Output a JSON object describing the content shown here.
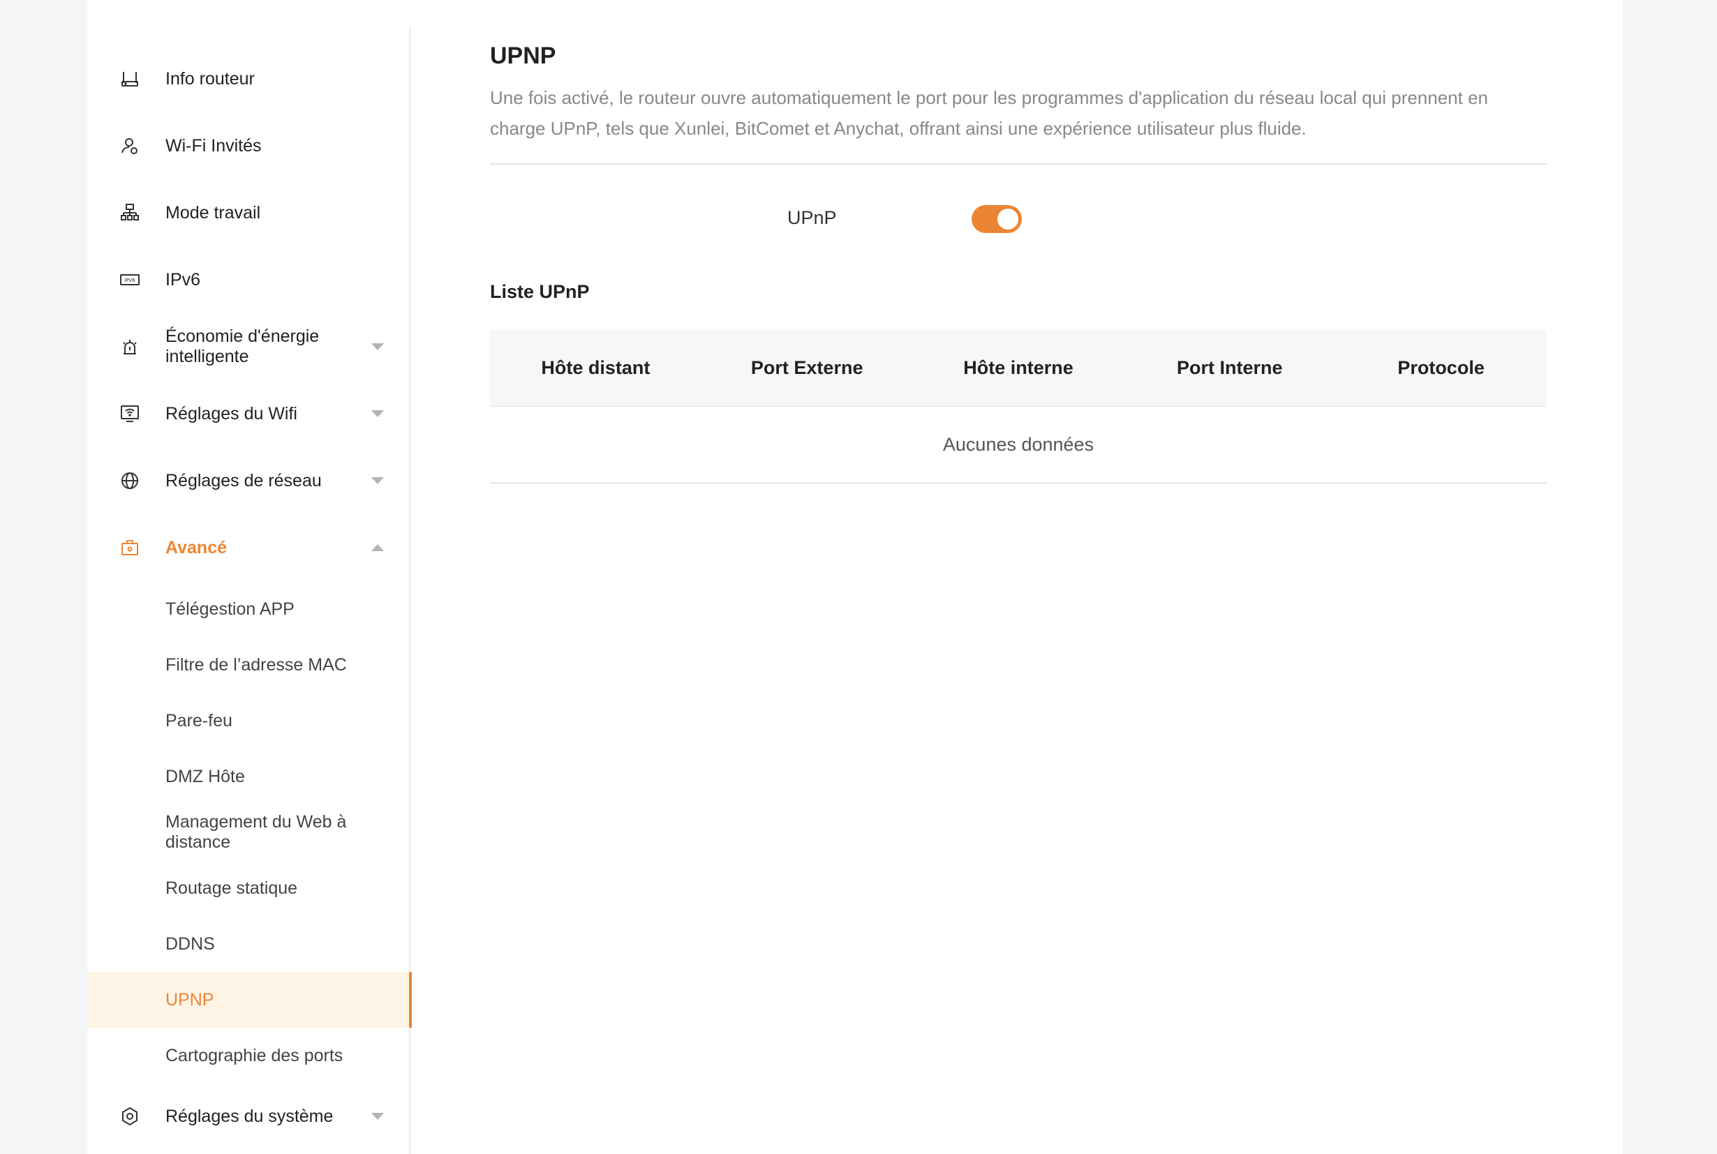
{
  "sidebar": {
    "items": [
      {
        "label": "Info routeur",
        "icon": "router-icon"
      },
      {
        "label": "Wi-Fi Invités",
        "icon": "guest-user-icon"
      },
      {
        "label": "Mode travail",
        "icon": "network-topology-icon"
      },
      {
        "label": "IPv6",
        "icon": "ipv6-icon"
      },
      {
        "label": "Économie d'énergie intelligente",
        "icon": "alarm-clock-icon"
      },
      {
        "label": "Réglages du Wifi",
        "icon": "wifi-screen-icon"
      },
      {
        "label": "Réglages de réseau",
        "icon": "globe-icon"
      },
      {
        "label": "Avancé",
        "icon": "toolbox-icon"
      },
      {
        "label": "Réglages du système",
        "icon": "gear-hex-icon"
      }
    ],
    "advanced_sub": [
      "Télégestion APP",
      "Filtre de l’adresse MAC",
      "Pare-feu",
      "DMZ Hôte",
      "Management du Web à distance",
      "Routage statique",
      "DDNS",
      "UPNP",
      "Cartographie des ports"
    ]
  },
  "main": {
    "title": "UPNP",
    "description": "Une fois activé, le routeur ouvre automatiquement le port pour les programmes d'application du réseau local qui prennent en charge UPnP, tels que Xunlei, BitComet et Anychat, offrant ainsi une expérience utilisateur plus fluide.",
    "upnp_label": "UPnP",
    "upnp_enabled": true,
    "list_title": "Liste UPnP",
    "columns": [
      "Hôte distant",
      "Port Externe",
      "Hôte interne",
      "Port Interne",
      "Protocole"
    ],
    "empty_text": "Aucunes données"
  },
  "colors": {
    "accent": "#ec8533",
    "selected_bg": "#fdf4e6"
  }
}
